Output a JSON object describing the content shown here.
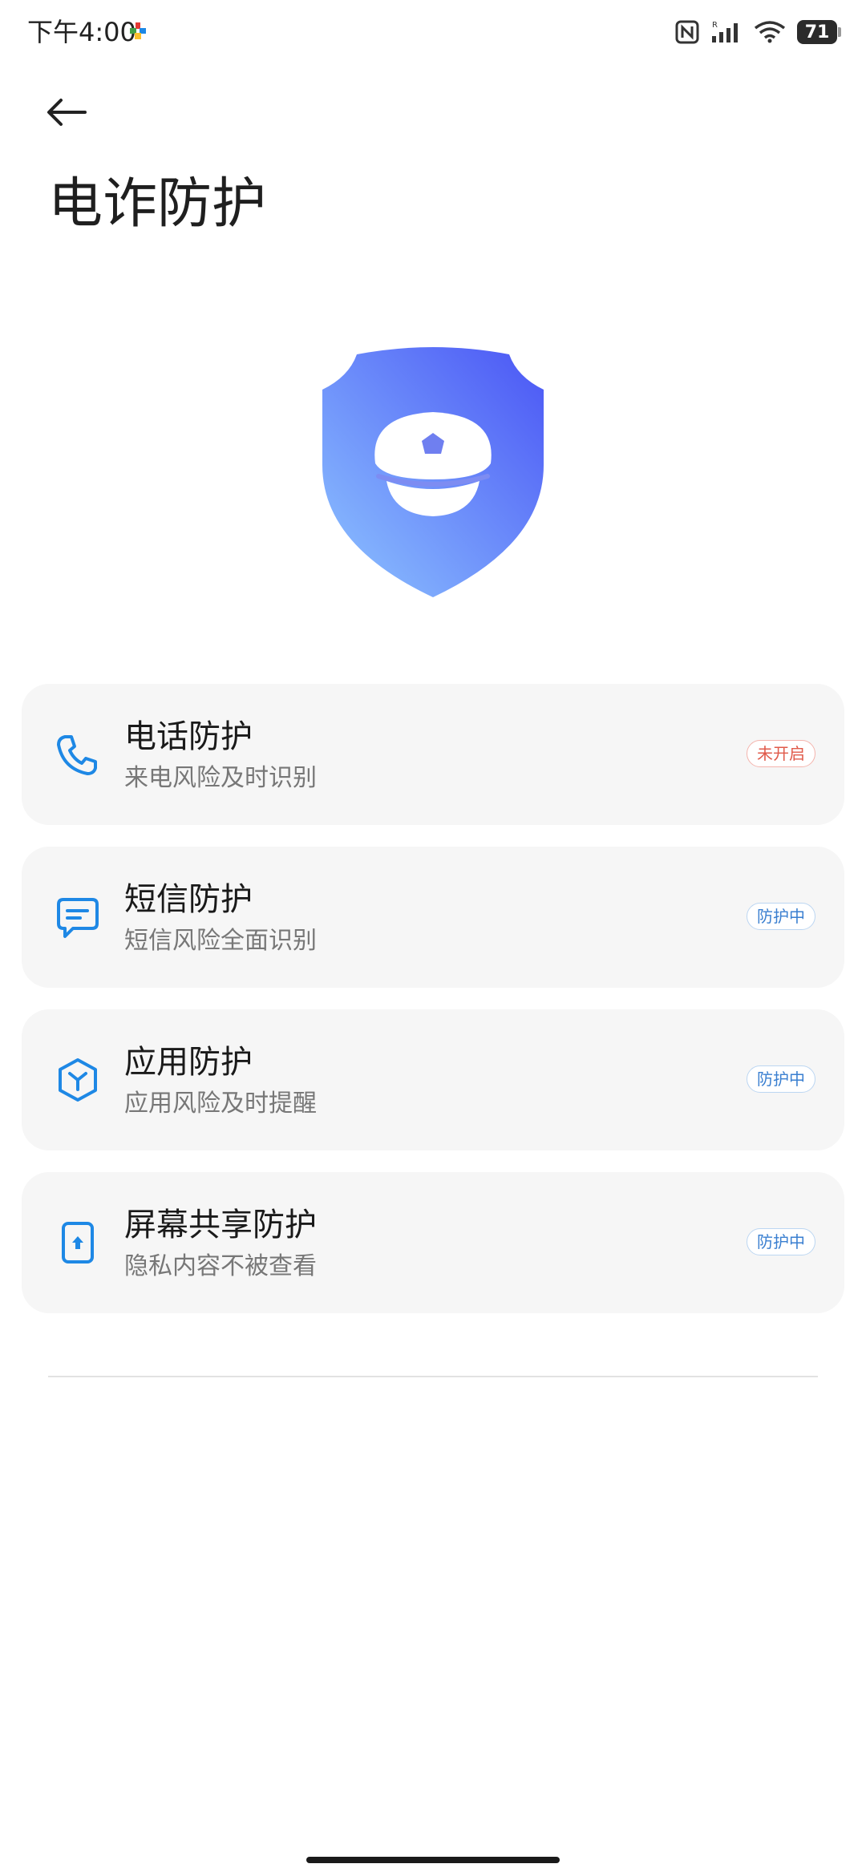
{
  "status_bar": {
    "time": "下午4:00",
    "battery": "71"
  },
  "header": {
    "title": "电诈防护"
  },
  "cards": [
    {
      "title": "电话防护",
      "subtitle": "来电风险及时识别",
      "status": "未开启",
      "icon": "phone-icon"
    },
    {
      "title": "短信防护",
      "subtitle": "短信风险全面识别",
      "status": "防护中",
      "icon": "message-icon"
    },
    {
      "title": "应用防护",
      "subtitle": "应用风险及时提醒",
      "status": "防护中",
      "icon": "app-cube-icon"
    },
    {
      "title": "屏幕共享防护",
      "subtitle": "隐私内容不被查看",
      "status": "防护中",
      "icon": "screen-share-icon"
    }
  ],
  "colors": {
    "accent": "#1e88e5",
    "status_off": "#e05a4a",
    "status_on": "#3a7fd0",
    "card_bg": "#f6f6f6"
  }
}
